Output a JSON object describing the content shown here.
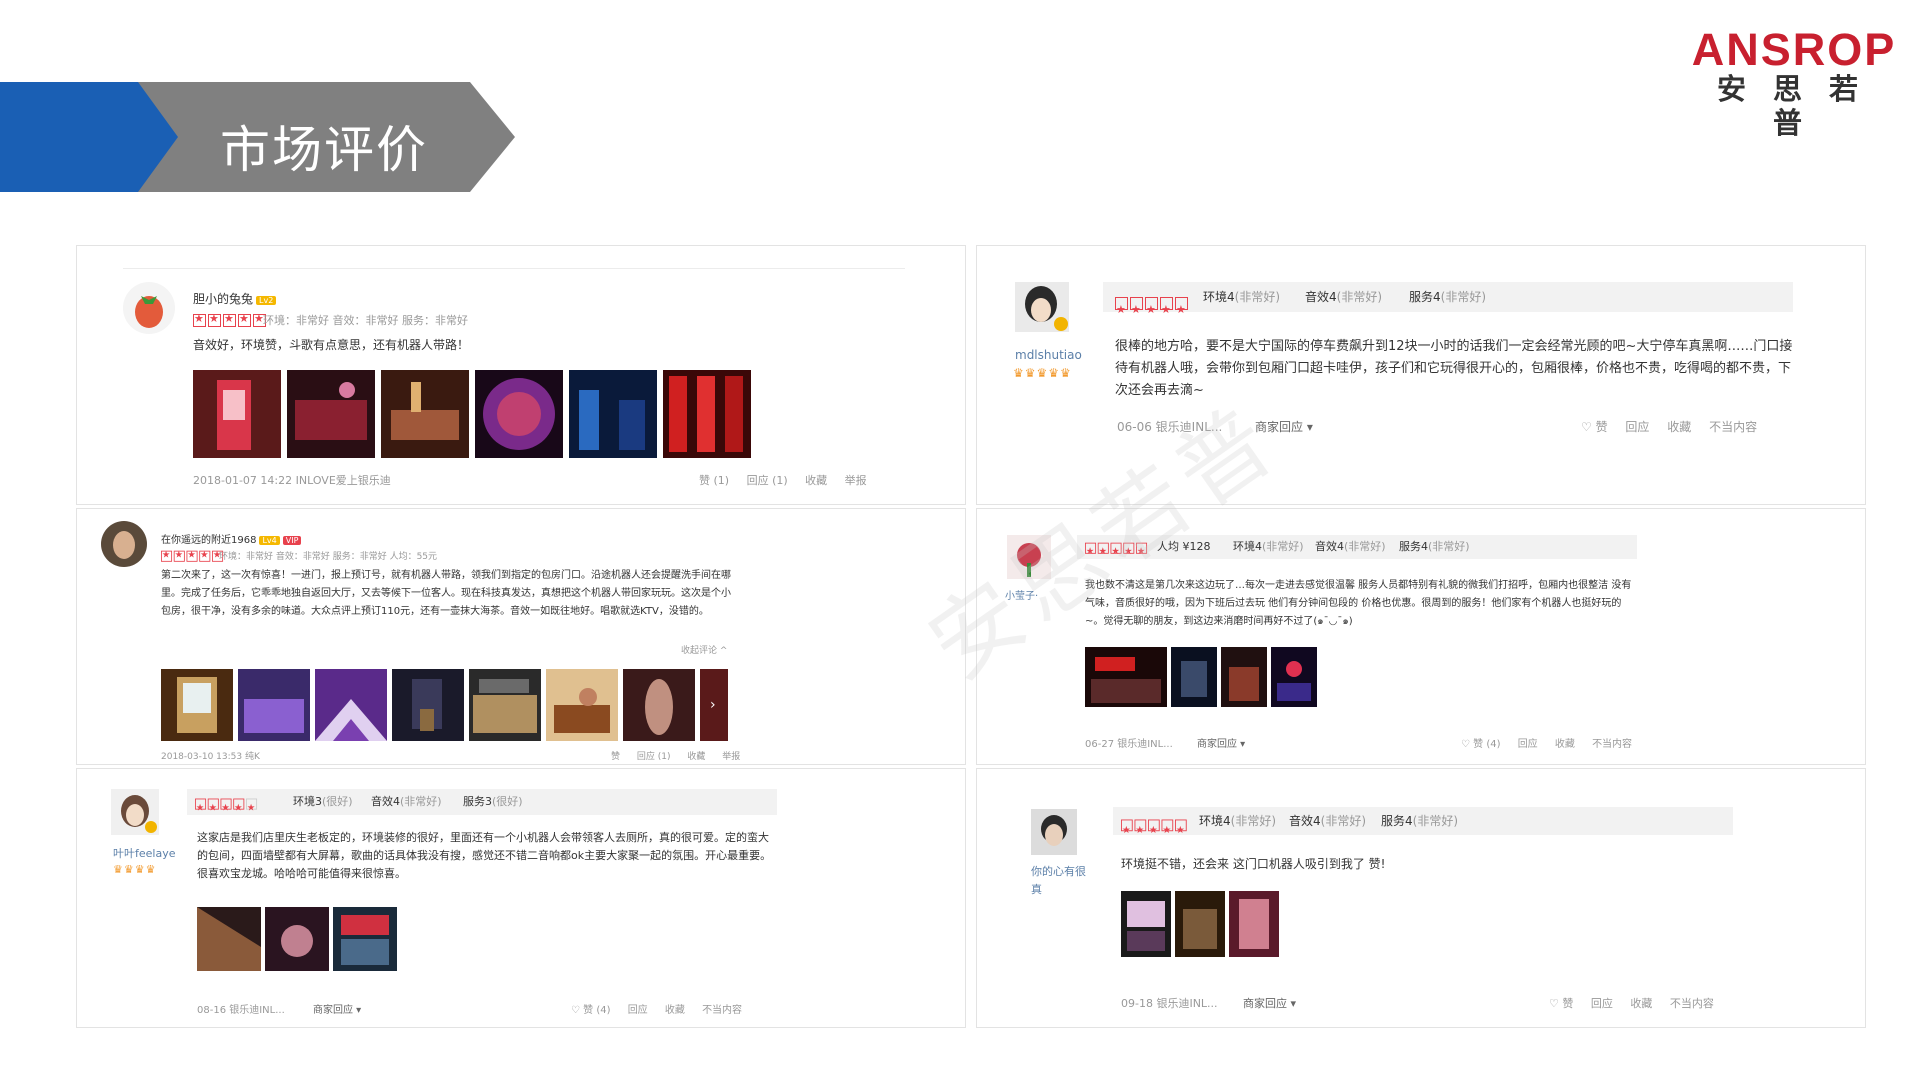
{
  "header": {
    "title": "市场评价"
  },
  "logo": {
    "en": "ANSROP",
    "cn": "安思若普"
  },
  "watermark": "安思若普",
  "reviews": {
    "r1": {
      "user": "胆小的兔兔",
      "level": "Lv2",
      "sub": "环境：非常好  音效：非常好  服务：非常好",
      "text": "音效好，环境赞，斗歌有点意思，还有机器人带路！",
      "meta": "2018-01-07 14:22   INLOVE爱上银乐迪",
      "actions": [
        "赞 (1)",
        "回应 (1)",
        "收藏",
        "举报"
      ]
    },
    "r2": {
      "user": "mdlshutiao",
      "env": "环境4",
      "env_q": "(非常好)",
      "snd": "音效4",
      "snd_q": "(非常好)",
      "svc": "服务4",
      "svc_q": "(非常好)",
      "text": "很棒的地方哈，要不是大宁国际的停车费飙升到12块一小时的话我们一定会经常光顾的吧~大宁停车真黑啊……门口接待有机器人哦，会带你到包厢门口超卡哇伊，孩子们和它玩得很开心的，包厢很棒，价格也不贵，吃得喝的都不贵，下次还会再去滴~",
      "meta": "06-06  银乐迪INL...",
      "reply": "商家回应 ▾",
      "actions": [
        "♡ 赞",
        "回应",
        "收藏",
        "不当内容"
      ]
    },
    "r3": {
      "user": "在你遥远的附近1968",
      "level": "Lv4",
      "vip": "VIP",
      "sub": "环境：非常好  音效：非常好  服务：非常好  人均：55元",
      "text": "第二次来了，这一次有惊喜！一进门，报上预订号，就有机器人带路，领我们到指定的包房门口。沿途机器人还会提醒洗手间在哪里。完成了任务后，它乖乖地独自返回大厅，又去等候下一位客人。现在科技真发达，真想把这个机器人带回家玩玩。这次是个小包房，很干净，没有多余的味道。大众点评上预订110元，还有一壶抹大海茶。音效一如既往地好。唱歌就选KTV，没错的。",
      "fold": "收起评论 ^",
      "meta": "2018-03-10 13:53   纯K",
      "actions": [
        "赞",
        "回应 (1)",
        "收藏",
        "举报"
      ]
    },
    "r4": {
      "user": "小莹子·",
      "avg": "人均 ¥128",
      "env": "环境4",
      "env_q": "(非常好)",
      "snd": "音效4",
      "snd_q": "(非常好)",
      "svc": "服务4",
      "svc_q": "(非常好)",
      "text": "我也数不清这是第几次来这边玩了…每次一走进去感觉很温馨 服务人员都特别有礼貌的微我们打招呼，包厢内也很整洁 没有气味，音质很好的哦，因为下班后过去玩 他们有分钟间包段的 价格也优惠。很周到的服务！他们家有个机器人也挺好玩的~。觉得无聊的朋友，到这边来消磨时间再好不过了(๑¯◡¯๑)",
      "meta": "06-27  银乐迪INL...",
      "reply": "商家回应 ▾",
      "actions": [
        "♡ 赞 (4)",
        "回应",
        "收藏",
        "不当内容"
      ]
    },
    "r5": {
      "user": "叶叶feelaye",
      "env": "环境3",
      "env_q": "(很好)",
      "snd": "音效4",
      "snd_q": "(非常好)",
      "svc": "服务3",
      "svc_q": "(很好)",
      "text": "这家店是我们店里庆生老板定的，环境装修的很好，里面还有一个小机器人会带领客人去厕所，真的很可爱。定的蛮大的包间，四面墙壁都有大屏幕，歌曲的话具体我没有搜，感觉还不错二音响都ok主要大家聚一起的氛围。开心最重要。很喜欢宝龙城。哈哈哈可能值得来很惊喜。",
      "meta": "08-16  银乐迪INL...",
      "reply": "商家回应 ▾",
      "actions": [
        "♡ 赞 (4)",
        "回应",
        "收藏",
        "不当内容"
      ]
    },
    "r6": {
      "user": "你的心有很真",
      "env": "环境4",
      "env_q": "(非常好)",
      "snd": "音效4",
      "snd_q": "(非常好)",
      "svc": "服务4",
      "svc_q": "(非常好)",
      "text": "环境挺不错，还会来 这门口机器人吸引到我了 赞!",
      "meta": "09-18  银乐迪INL...",
      "reply": "商家回应 ▾",
      "actions": [
        "♡ 赞",
        "回应",
        "收藏",
        "不当内容"
      ]
    }
  },
  "colors": {
    "accent_blue": "#1a5fb4",
    "banner_grey": "#808080",
    "brand_red": "#c8202f",
    "star_red": "#e8424d"
  }
}
